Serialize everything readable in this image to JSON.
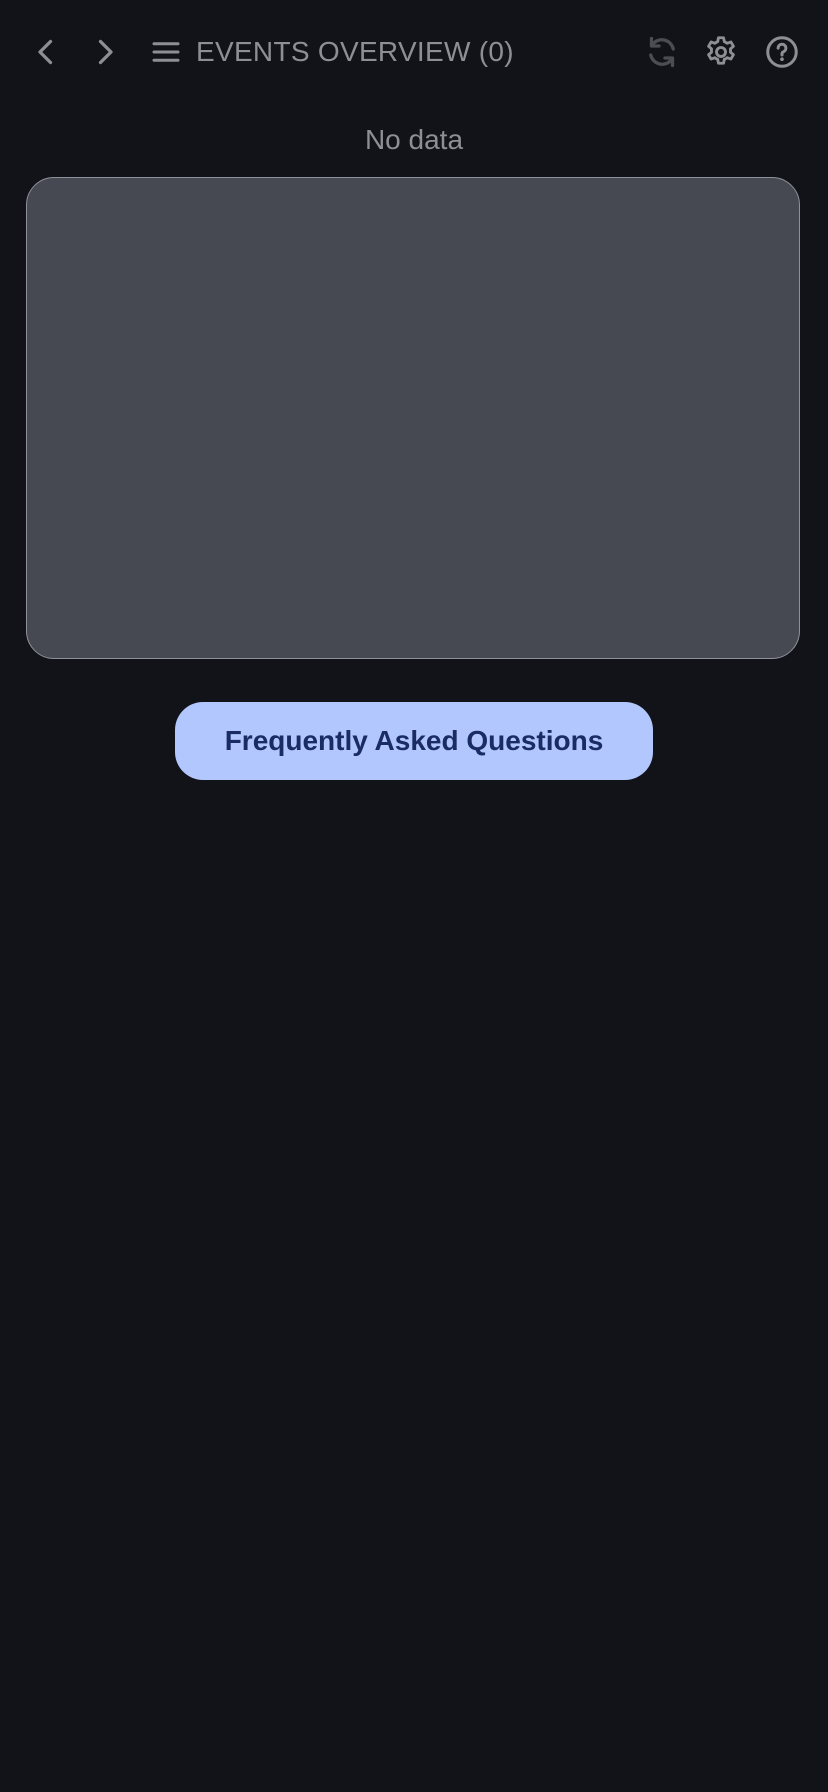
{
  "header": {
    "title": "EVENTS OVERVIEW (0)",
    "icons": {
      "back": "chevron-left-icon",
      "forward": "chevron-right-icon",
      "menu": "hamburger-menu-icon",
      "refresh": "refresh-icon",
      "settings": "gear-icon",
      "help": "help-circle-icon"
    }
  },
  "main": {
    "empty_label": "No data",
    "faq_button_label": "Frequently Asked Questions"
  },
  "colors": {
    "background": "#121318",
    "text_muted": "#8d8f96",
    "panel": "#464951",
    "accent_button": "#b3c7ff",
    "accent_button_text": "#1a2c61"
  }
}
